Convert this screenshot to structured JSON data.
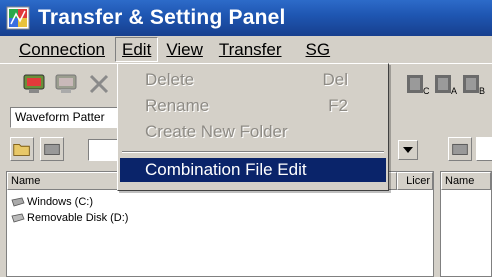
{
  "window": {
    "title": "Transfer & Setting Panel",
    "title_bar_color": "#1f57b3"
  },
  "menu": {
    "connection": "Connection",
    "edit": "Edit",
    "view": "View",
    "transfer": "Transfer",
    "sg": "SG"
  },
  "edit_menu": {
    "items": [
      {
        "label": "Delete",
        "shortcut": "Del",
        "enabled": false
      },
      {
        "label": "Rename",
        "shortcut": "F2",
        "enabled": false
      },
      {
        "label": "Create New Folder",
        "shortcut": "",
        "enabled": false
      },
      {
        "label": "Combination File Edit",
        "shortcut": "",
        "enabled": true,
        "highlighted": true
      }
    ],
    "highlight_color": "#0a246a"
  },
  "toolbar": {
    "icons": [
      "connect-icon",
      "disconnect-icon",
      "delete-icon",
      "channel-c-icon",
      "channel-a-icon",
      "channel-b-icon"
    ],
    "waveform_field": "Waveform Patter"
  },
  "file_panel": {
    "columns": {
      "name": "Name",
      "license": "Licer",
      "right_name": "Name"
    },
    "drives": [
      {
        "label": "Windows (C:)"
      },
      {
        "label": "Removable Disk (D:)"
      }
    ]
  }
}
